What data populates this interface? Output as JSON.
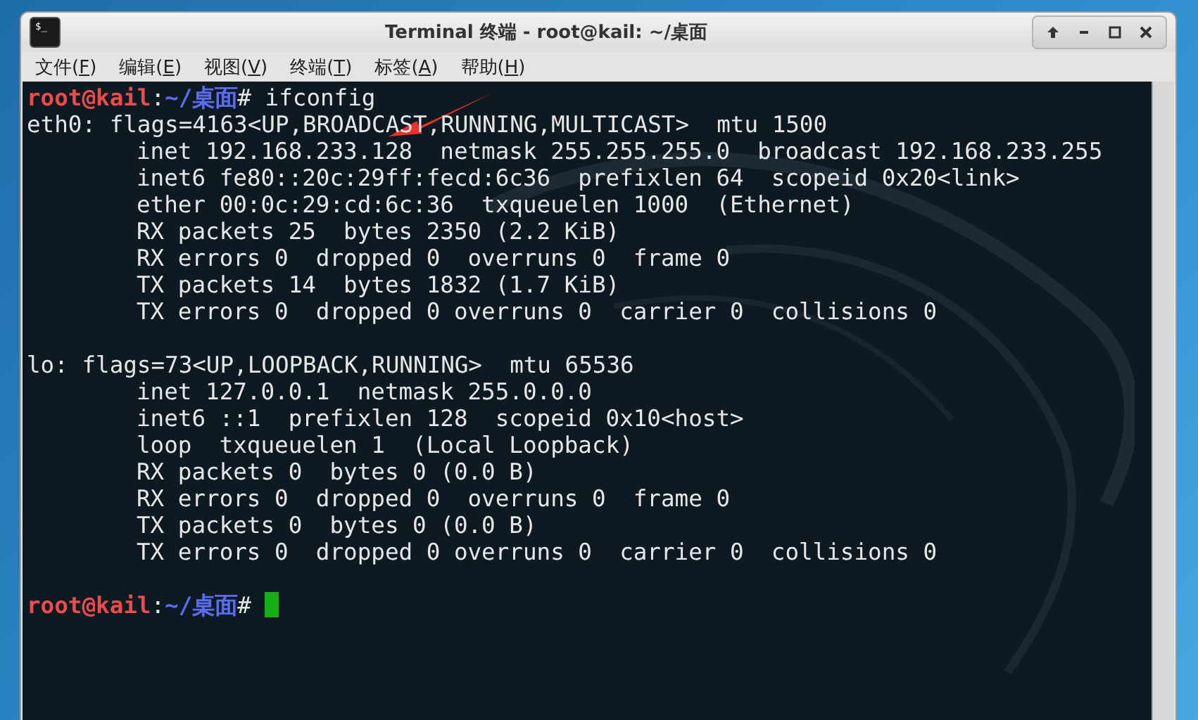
{
  "window": {
    "icon_text": "$_",
    "title": "Terminal 终端 - root@kail: ~/桌面"
  },
  "menu": [
    "文件(F)",
    "编辑(E)",
    "视图(V)",
    "终端(T)",
    "标签(A)",
    "帮助(H)"
  ],
  "terminal": {
    "lines": [
      {
        "kind": "prompt",
        "user": "root@kail",
        "separator": ":",
        "path": "~/桌面",
        "symbol": "#",
        "command": "ifconfig",
        "cursor": false
      },
      {
        "kind": "header",
        "text": "eth0: flags=4163<UP,BROADCAST,RUNNING,MULTICAST>  mtu 1500"
      },
      {
        "kind": "detail",
        "text": "inet 192.168.233.128  netmask 255.255.255.0  broadcast 192.168.233.255"
      },
      {
        "kind": "detail",
        "text": "inet6 fe80::20c:29ff:fecd:6c36  prefixlen 64  scopeid 0x20<link>"
      },
      {
        "kind": "detail",
        "text": "ether 00:0c:29:cd:6c:36  txqueuelen 1000  (Ethernet)"
      },
      {
        "kind": "detail",
        "text": "RX packets 25  bytes 2350 (2.2 KiB)"
      },
      {
        "kind": "detail",
        "text": "RX errors 0  dropped 0  overruns 0  frame 0"
      },
      {
        "kind": "detail",
        "text": "TX packets 14  bytes 1832 (1.7 KiB)"
      },
      {
        "kind": "detail",
        "text": "TX errors 0  dropped 0 overruns 0  carrier 0  collisions 0"
      },
      {
        "kind": "blank"
      },
      {
        "kind": "header",
        "text": "lo: flags=73<UP,LOOPBACK,RUNNING>  mtu 65536"
      },
      {
        "kind": "detail",
        "text": "inet 127.0.0.1  netmask 255.0.0.0"
      },
      {
        "kind": "detail",
        "text": "inet6 ::1  prefixlen 128  scopeid 0x10<host>"
      },
      {
        "kind": "detail",
        "text": "loop  txqueuelen 1  (Local Loopback)"
      },
      {
        "kind": "detail",
        "text": "RX packets 0  bytes 0 (0.0 B)"
      },
      {
        "kind": "detail",
        "text": "RX errors 0  dropped 0  overruns 0  frame 0"
      },
      {
        "kind": "detail",
        "text": "TX packets 0  bytes 0 (0.0 B)"
      },
      {
        "kind": "detail",
        "text": "TX errors 0  dropped 0 overruns 0  carrier 0  collisions 0"
      },
      {
        "kind": "blank"
      },
      {
        "kind": "prompt",
        "user": "root@kail",
        "separator": ":",
        "path": "~/桌面",
        "symbol": "#",
        "cursor": true
      }
    ]
  }
}
